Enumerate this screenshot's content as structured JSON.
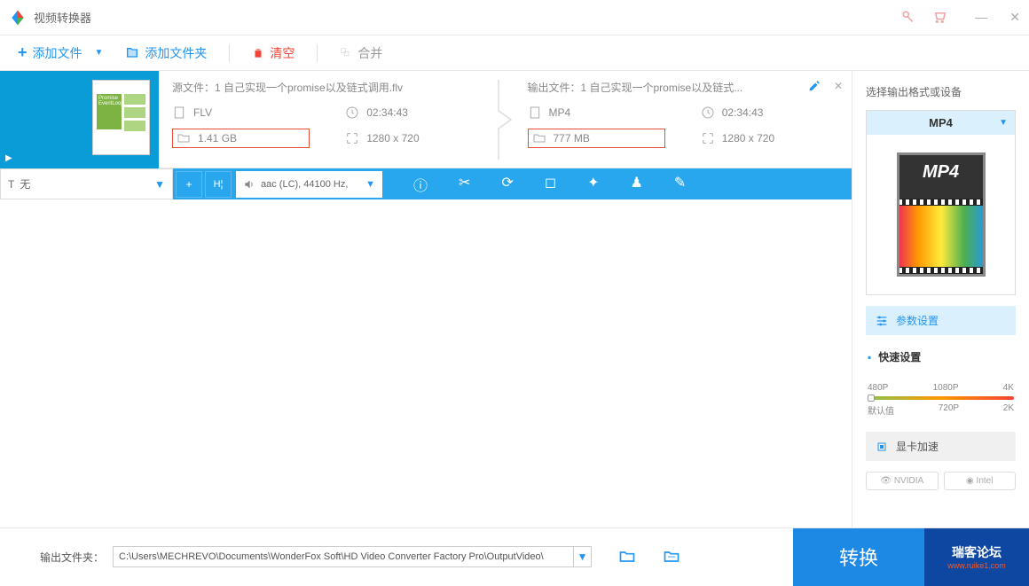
{
  "title": "视频转换器",
  "toolbar": {
    "add_file": "添加文件",
    "add_folder": "添加文件夹",
    "clear": "清空",
    "merge": "合并"
  },
  "file": {
    "source_label": "源文件：1 自己实现一个promise以及链式调用.flv",
    "output_label": "输出文件：1 自己实现一个promise以及链式...",
    "src_format": "FLV",
    "src_duration": "02:34:43",
    "src_size": "1.41 GB",
    "src_resolution": "1280 x 720",
    "out_format": "MP4",
    "out_duration": "02:34:43",
    "out_size": "777 MB",
    "out_resolution": "1280 x 720",
    "thumb_text": "Promise EventLoop"
  },
  "editbar": {
    "subtitle": "无",
    "audio": "aac (LC), 44100 Hz,"
  },
  "sidebar": {
    "title": "选择输出格式或设备",
    "format": "MP4",
    "mp4_label": "MP4",
    "params": "参数设置",
    "quick": "快速设置",
    "quality": {
      "p480": "480P",
      "p720": "720P",
      "p1080": "1080P",
      "p2k": "2K",
      "p4k": "4K",
      "default": "默认值"
    },
    "gpu": "显卡加速",
    "nvidia": "NVIDIA",
    "intel": "Intel"
  },
  "bottom": {
    "label": "输出文件夹：",
    "path": "C:\\Users\\MECHREVO\\Documents\\WonderFox Soft\\HD Video Converter Factory Pro\\OutputVideo\\",
    "convert": "转换",
    "wm1": "瑞客论坛",
    "wm2": "www.ruike1.com"
  }
}
